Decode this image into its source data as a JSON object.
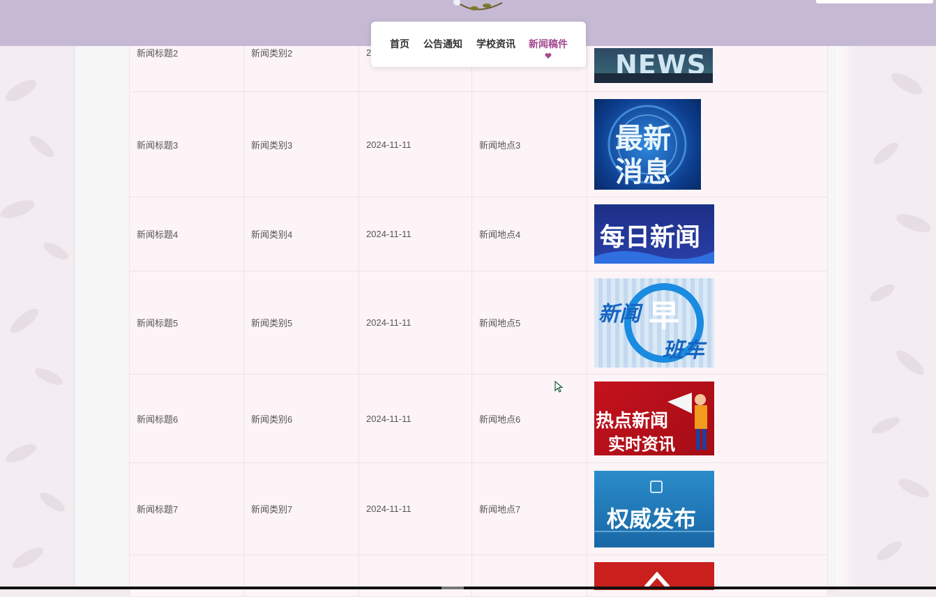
{
  "nav": {
    "items": [
      {
        "label": "首页"
      },
      {
        "label": "公告通知"
      },
      {
        "label": "学校资讯"
      },
      {
        "label": "新闻稿件"
      }
    ],
    "active_index": 3
  },
  "table": {
    "rows": [
      {
        "title": "新闻标题2",
        "category": "新闻类别2",
        "date": "2",
        "location": "",
        "image_text": "NEWS"
      },
      {
        "title": "新闻标题3",
        "category": "新闻类别3",
        "date": "2024-11-11",
        "location": "新闻地点3",
        "image_text": "最新消息"
      },
      {
        "title": "新闻标题4",
        "category": "新闻类别4",
        "date": "2024-11-11",
        "location": "新闻地点4",
        "image_text": "每日新闻"
      },
      {
        "title": "新闻标题5",
        "category": "新闻类别5",
        "date": "2024-11-11",
        "location": "新闻地点5",
        "image_text": "新闻早班车"
      },
      {
        "title": "新闻标题6",
        "category": "新闻类别6",
        "date": "2024-11-11",
        "location": "新闻地点6",
        "image_text": "热点新闻 实时资讯"
      },
      {
        "title": "新闻标题7",
        "category": "新闻类别7",
        "date": "2024-11-11",
        "location": "新闻地点7",
        "image_text": "权威发布"
      },
      {
        "title": "",
        "category": "",
        "date": "",
        "location": "",
        "image_text": ""
      }
    ]
  },
  "thumb_text": {
    "news": "NEWS",
    "zuixin_line1": "最新",
    "zuixin_line2": "消息",
    "meiri": "每日新闻",
    "zaoban_a": "新闻",
    "zaoban_b": "早",
    "zaoban_c": "班车",
    "redian_line1": "热点新闻",
    "redian_line2": "实时资讯",
    "quanwei": "权威发布"
  },
  "colors": {
    "header_bg": "#c5b9d4",
    "nav_active": "#a24a8f",
    "table_bg": "#fdf4f8"
  }
}
